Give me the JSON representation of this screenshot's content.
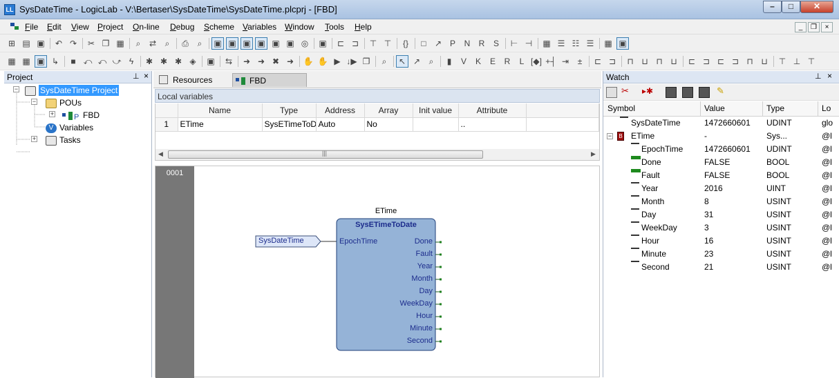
{
  "window": {
    "title": "SysDateTime - LogicLab - V:\\Bertaser\\SysDateTime\\SysDateTime.plcprj - [FBD]",
    "icon": "logiclab-icon"
  },
  "menu": [
    {
      "u": "F",
      "rest": "ile"
    },
    {
      "u": "E",
      "rest": "dit"
    },
    {
      "u": "V",
      "rest": "iew"
    },
    {
      "u": "P",
      "rest": "roject"
    },
    {
      "u": "O",
      "rest": "n-line"
    },
    {
      "u": "D",
      "rest": "ebug"
    },
    {
      "u": "S",
      "rest": "cheme"
    },
    {
      "u": "V",
      "rest": "ariables"
    },
    {
      "u": "W",
      "rest": "indow"
    },
    {
      "u": "T",
      "rest": "ools"
    },
    {
      "u": "H",
      "rest": "elp"
    }
  ],
  "project": {
    "title": "Project",
    "root": "SysDateTime Project",
    "pous": "POUs",
    "fbd": "FBD",
    "variables": "Variables",
    "tasks": "Tasks"
  },
  "tabs": {
    "resources": "Resources",
    "fbd": "FBD"
  },
  "local_vars": {
    "title": "Local variables",
    "columns": [
      "",
      "Name",
      "Type",
      "Address",
      "Array",
      "Init value",
      "Attribute"
    ],
    "rows": [
      [
        "1",
        "ETime",
        "SysETimeToD",
        "Auto",
        "No",
        "",
        ".."
      ]
    ]
  },
  "fbd": {
    "network": "0001",
    "instance": "ETime",
    "block": "SysETimeToDate",
    "input_var": "SysDateTime",
    "input_pin": "EpochTime",
    "outputs": [
      "Done",
      "Fault",
      "Year",
      "Month",
      "Day",
      "WeekDay",
      "Hour",
      "Minute",
      "Second"
    ]
  },
  "watch": {
    "title": "Watch",
    "columns": [
      "Symbol",
      "Value",
      "Type",
      "Lo"
    ],
    "rows": [
      {
        "symbol": "SysDateTime",
        "value": "1472660601",
        "type": "UDINT",
        "loc": "glo",
        "level": 0,
        "marker": "dash"
      },
      {
        "symbol": "ETime",
        "value": "-",
        "type": "Sys...",
        "loc": "@l",
        "level": 0,
        "marker": "block"
      },
      {
        "symbol": "EpochTime",
        "value": "1472660601",
        "type": "UDINT",
        "loc": "@l",
        "level": 1,
        "marker": "dash"
      },
      {
        "symbol": "Done",
        "value": "FALSE",
        "type": "BOOL",
        "loc": "@l",
        "level": 1,
        "marker": "green"
      },
      {
        "symbol": "Fault",
        "value": "FALSE",
        "type": "BOOL",
        "loc": "@l",
        "level": 1,
        "marker": "green"
      },
      {
        "symbol": "Year",
        "value": "2016",
        "type": "UINT",
        "loc": "@l",
        "level": 1,
        "marker": "dash"
      },
      {
        "symbol": "Month",
        "value": "8",
        "type": "USINT",
        "loc": "@l",
        "level": 1,
        "marker": "dash"
      },
      {
        "symbol": "Day",
        "value": "31",
        "type": "USINT",
        "loc": "@l",
        "level": 1,
        "marker": "dash"
      },
      {
        "symbol": "WeekDay",
        "value": "3",
        "type": "USINT",
        "loc": "@l",
        "level": 1,
        "marker": "dash"
      },
      {
        "symbol": "Hour",
        "value": "16",
        "type": "USINT",
        "loc": "@l",
        "level": 1,
        "marker": "dash"
      },
      {
        "symbol": "Minute",
        "value": "23",
        "type": "USINT",
        "loc": "@l",
        "level": 1,
        "marker": "dash"
      },
      {
        "symbol": "Second",
        "value": "21",
        "type": "USINT",
        "loc": "@l",
        "level": 1,
        "marker": "dash"
      }
    ]
  },
  "colors": {
    "block_fill": "#95b3d7",
    "block_border": "#1f3f7a",
    "pin_text": "#1c2c8c",
    "selection": "#3399ff"
  }
}
